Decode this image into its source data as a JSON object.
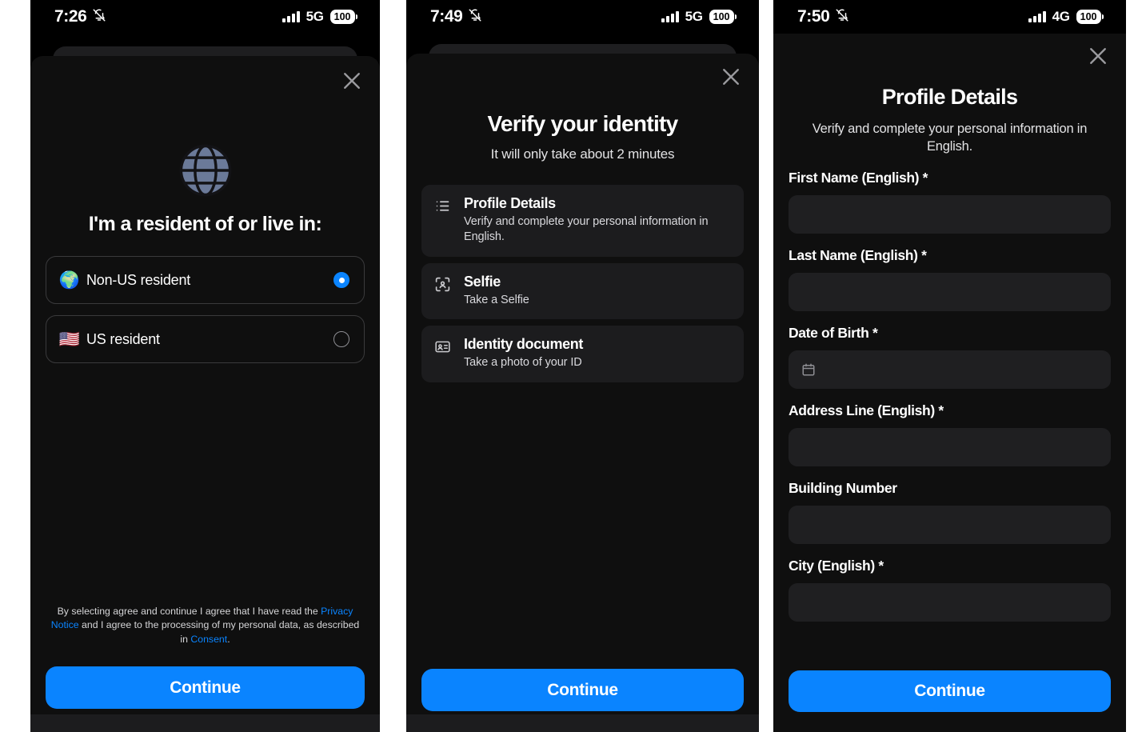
{
  "accent": "#0a84ff",
  "panels": [
    {
      "id": "residency",
      "status": {
        "time": "7:26",
        "network": "5G",
        "battery": "100",
        "silent_icon": "bell-slash-icon"
      },
      "close_label": "×",
      "hero_icon": "globe-icon",
      "title": "I'm a resident of or live in:",
      "options": [
        {
          "emoji": "🌍",
          "icon_name": "globe-emoji-icon",
          "label": "Non-US resident",
          "selected": true
        },
        {
          "emoji": "🇺🇸",
          "icon_name": "us-flag-emoji-icon",
          "label": "US resident",
          "selected": false
        }
      ],
      "legal": {
        "part1": "By selecting agree and continue I agree that I have read the ",
        "link1": "Privacy Notice",
        "part2": " and I agree to the processing of my personal data, as described in ",
        "link2": "Consent",
        "part3": "."
      },
      "cta": "Continue"
    },
    {
      "id": "verify-identity",
      "status": {
        "time": "7:49",
        "network": "5G",
        "battery": "100",
        "silent_icon": "bell-slash-icon"
      },
      "close_label": "×",
      "title": "Verify your identity",
      "subtitle": "It will only take about 2 minutes",
      "tasks": [
        {
          "icon": "list-bullets-icon",
          "title": "Profile Details",
          "desc": "Verify and complete your personal information in English."
        },
        {
          "icon": "face-scan-icon",
          "title": "Selfie",
          "desc": "Take a Selfie"
        },
        {
          "icon": "id-card-icon",
          "title": "Identity document",
          "desc": "Take a photo of your ID"
        }
      ],
      "cta": "Continue"
    },
    {
      "id": "profile-details",
      "status": {
        "time": "7:50",
        "network": "4G",
        "battery": "100",
        "silent_icon": "bell-slash-icon"
      },
      "close_label": "×",
      "title": "Profile Details",
      "subtitle": "Verify and complete your personal information in English.",
      "fields": [
        {
          "label": "First Name (English) *",
          "value": "",
          "icon": null
        },
        {
          "label": "Last Name (English) *",
          "value": "",
          "icon": null
        },
        {
          "label": "Date of Birth *",
          "value": "",
          "icon": "calendar-icon"
        },
        {
          "label": "Address Line (English) *",
          "value": "",
          "icon": null
        },
        {
          "label": "Building Number",
          "value": "",
          "icon": null
        },
        {
          "label": "City (English) *",
          "value": "",
          "icon": null
        }
      ],
      "cta": "Continue"
    }
  ]
}
